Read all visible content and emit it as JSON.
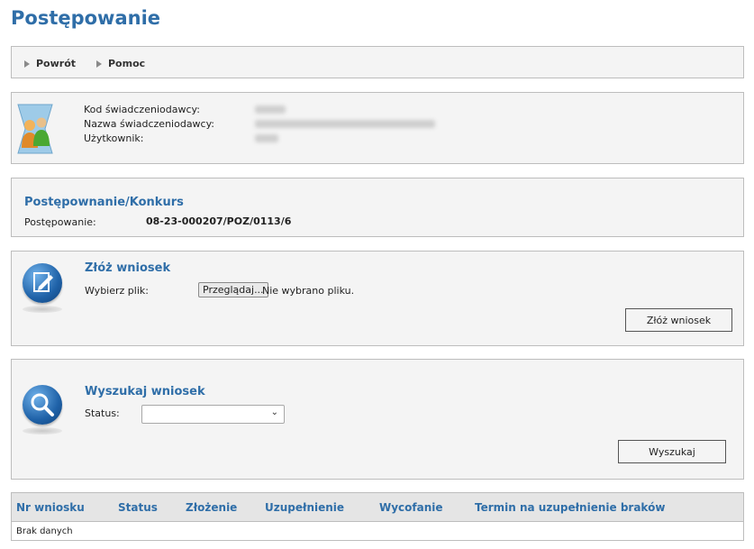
{
  "page": {
    "title": "Postępowanie"
  },
  "toolbar": {
    "back_label": "Powrót",
    "help_label": "Pomoc"
  },
  "provider": {
    "code_label": "Kod świadczeniodawcy:",
    "name_label": "Nazwa świadczeniodawcy:",
    "user_label": "Użytkownik:",
    "icon": "users-icon"
  },
  "proceeding": {
    "title": "Postępownanie/Konkurs",
    "label": "Postępowanie:",
    "value": "08-23-000207/POZ/0113/6"
  },
  "submit": {
    "title": "Złóż wniosek",
    "file_label": "Wybierz plik:",
    "browse_label": "Przeglądaj...",
    "no_file_text": "Nie wybrano pliku.",
    "submit_button": "Złóż wniosek",
    "icon": "edit-document-icon"
  },
  "search": {
    "title": "Wyszukaj wniosek",
    "status_label": "Status:",
    "status_value": "",
    "search_button": "Wyszukaj",
    "icon": "magnifier-icon"
  },
  "table": {
    "columns": [
      "Nr wniosku",
      "Status",
      "Złożenie",
      "Uzupełnienie",
      "Wycofanie",
      "Termin na uzupełnienie braków"
    ],
    "empty_text": "Brak danych"
  }
}
